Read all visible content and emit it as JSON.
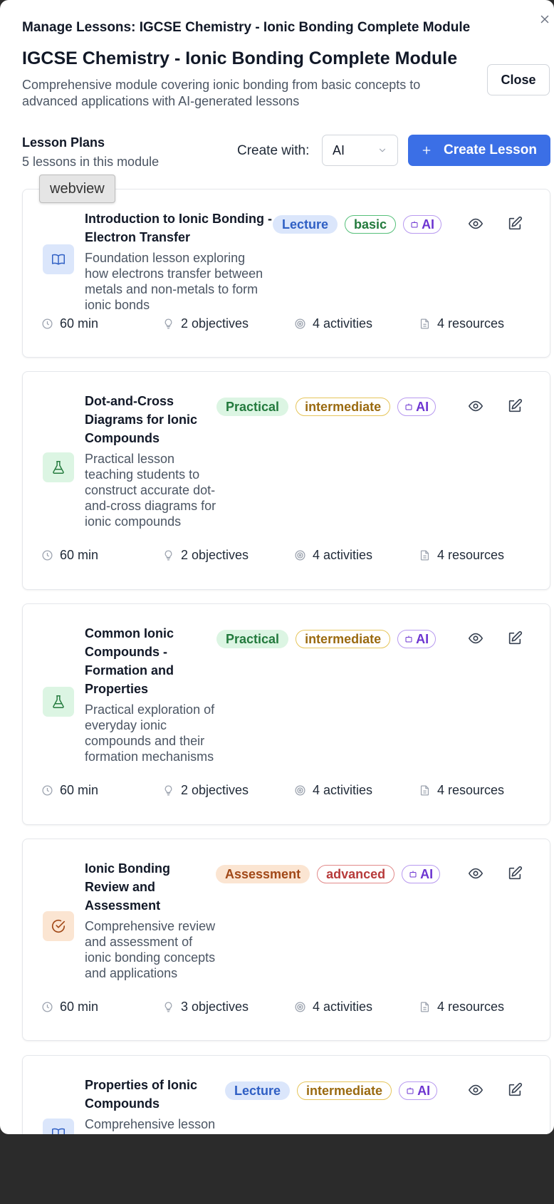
{
  "dialog": {
    "title": "Manage Lessons: IGCSE Chemistry - Ionic Bonding Complete Module",
    "close_label": "Close"
  },
  "module": {
    "title": "IGCSE Chemistry - Ionic Bonding Complete Module",
    "description": "Comprehensive module covering ionic bonding from basic concepts to advanced applications with AI-generated lessons"
  },
  "lesson_plans": {
    "heading": "Lesson Plans",
    "count_text": "5 lessons in this module",
    "create_with_label": "Create with:",
    "create_with_value": "AI",
    "create_button_label": "Create Lesson",
    "tooltip": "webview"
  },
  "colors": {
    "primary": "#3b6fe6",
    "lecture_bg": "#dbe6fb",
    "practical_bg": "#dcf5e3",
    "assessment_bg": "#fbe5d2"
  },
  "lessons": [
    {
      "icon": "book-icon",
      "title": "Introduction to Ionic Bonding - Electron Transfer",
      "description": "Foundation lesson exploring how electrons transfer between metals and non-metals to form ionic bonds",
      "type": "Lecture",
      "level": "basic",
      "ai": "AI",
      "duration": "60 min",
      "objectives": "2 objectives",
      "activities": "4 activities",
      "resources": "4 resources"
    },
    {
      "icon": "flask-icon",
      "title": "Dot-and-Cross Diagrams for Ionic Compounds",
      "description": "Practical lesson teaching students to construct accurate dot-and-cross diagrams for ionic compounds",
      "type": "Practical",
      "level": "intermediate",
      "ai": "AI",
      "duration": "60 min",
      "objectives": "2 objectives",
      "activities": "4 activities",
      "resources": "4 resources"
    },
    {
      "icon": "flask-icon",
      "title": "Common Ionic Compounds - Formation and Properties",
      "description": "Practical exploration of everyday ionic compounds and their formation mechanisms",
      "type": "Practical",
      "level": "intermediate",
      "ai": "AI",
      "duration": "60 min",
      "objectives": "2 objectives",
      "activities": "4 activities",
      "resources": "4 resources"
    },
    {
      "icon": "check-circle-icon",
      "title": "Ionic Bonding Review and Assessment",
      "description": "Comprehensive review and assessment of ionic bonding concepts and applications",
      "type": "Assessment",
      "level": "advanced",
      "ai": "AI",
      "duration": "60 min",
      "objectives": "3 objectives",
      "activities": "4 activities",
      "resources": "4 resources"
    },
    {
      "icon": "book-icon",
      "title": "Properties of Ionic Compounds",
      "description": "Comprehensive lesson exploring the relationship between ionic structure and physical properties",
      "type": "Lecture",
      "level": "intermediate",
      "ai": "AI"
    }
  ]
}
